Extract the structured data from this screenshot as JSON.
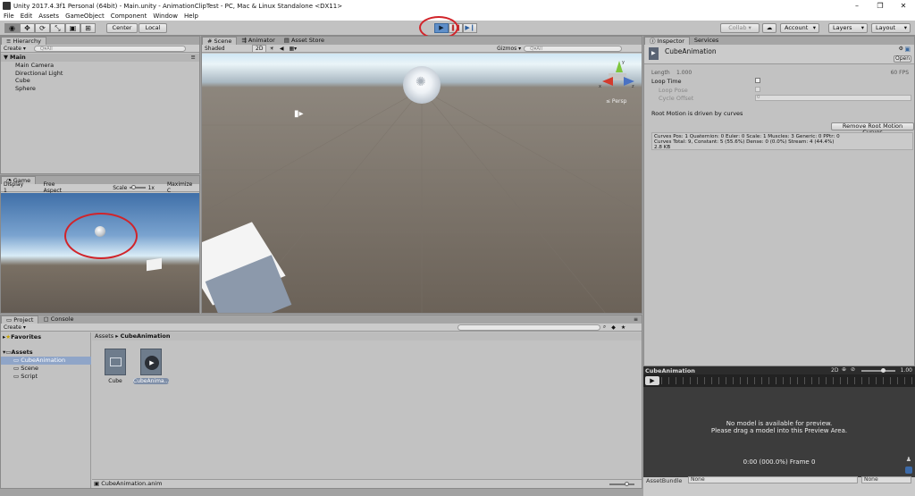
{
  "window": {
    "title": "Unity 2017.4.3f1 Personal (64bit) - Main.unity - AnimationClipTest - PC, Mac & Linux Standalone <DX11>",
    "controls": [
      "–",
      "❐",
      "✕"
    ]
  },
  "menu": [
    "File",
    "Edit",
    "Assets",
    "GameObject",
    "Component",
    "Window",
    "Help"
  ],
  "toolbar": {
    "pivot": "Center",
    "space": "Local",
    "collab": "Collab ▾",
    "account": "Account",
    "layers": "Layers",
    "layout": "Layout"
  },
  "hierarchy": {
    "tab": "Hierarchy",
    "create": "Create ▾",
    "search_placeholder": "Q▾All",
    "scene": "Main",
    "items": [
      "Main Camera",
      "Directional Light",
      "Cube",
      "Sphere"
    ]
  },
  "scene": {
    "tabs": [
      "Scene",
      "Animator",
      "Asset Store"
    ],
    "shading": "Shaded",
    "mode_2d": "2D",
    "gizmos": "Gizmos ▾",
    "search_placeholder": "Q▾All",
    "persp": "≤ Persp",
    "gizmo_axes": [
      "y",
      "x",
      "z"
    ]
  },
  "game": {
    "tab": "Game",
    "display": "Display 1",
    "aspect": "Free Aspect",
    "scale_label": "Scale",
    "scale_value": "1x",
    "maximize": "Maximize C"
  },
  "project": {
    "tabs": [
      "Project",
      "Console"
    ],
    "create": "Create ▾",
    "favorites": "Favorites",
    "assets_root": "Assets",
    "tree": [
      "CubeAnimation",
      "Scene",
      "Script"
    ],
    "breadcrumb": [
      "Assets",
      "CubeAnimation"
    ],
    "files": [
      {
        "name": "Cube",
        "icon": "animator-controller-icon"
      },
      {
        "name": "CubeAnima...",
        "icon": "animation-clip-icon"
      }
    ],
    "footer_file": "CubeAnimation.anim",
    "zoom_fraction": 0.75
  },
  "inspector": {
    "tabs": [
      "Inspector",
      "Services"
    ],
    "object_name": "CubeAnimation",
    "open_button": "Open",
    "length_label": "Length",
    "length_value": "1.000",
    "fps": "60 FPS",
    "loop_time": "Loop Time",
    "loop_pose": "Loop Pose",
    "cycle_offset": "Cycle Offset",
    "cycle_offset_value": "0",
    "root_motion_text": "Root Motion is driven by curves",
    "remove_button": "Remove Root Motion Curves",
    "info_lines": [
      "Curves Pos: 1 Quaternion: 0 Euler: 0 Scale: 1 Muscles: 3 Generic: 0 PPtr: 0",
      "Curves Total: 9, Constant: 5 (55.6%) Dense: 0 (0.0%) Stream: 4 (44.4%)",
      "2.8 KB"
    ]
  },
  "preview": {
    "title": "CubeAnimation",
    "mode_2d": "2D",
    "speed": "1.00",
    "msg1": "No model is available for preview.",
    "msg2": "Please drag a model into this Preview Area.",
    "time": "0:00 (000.0%) Frame 0",
    "assetbundle_label": "AssetBundle",
    "assetbundle_value": "None",
    "variant_value": "None"
  },
  "colors": {
    "highlight_red": "#d1242a",
    "play_blue": "#5f8fc9",
    "selection_blue": "#8fa5c8"
  }
}
